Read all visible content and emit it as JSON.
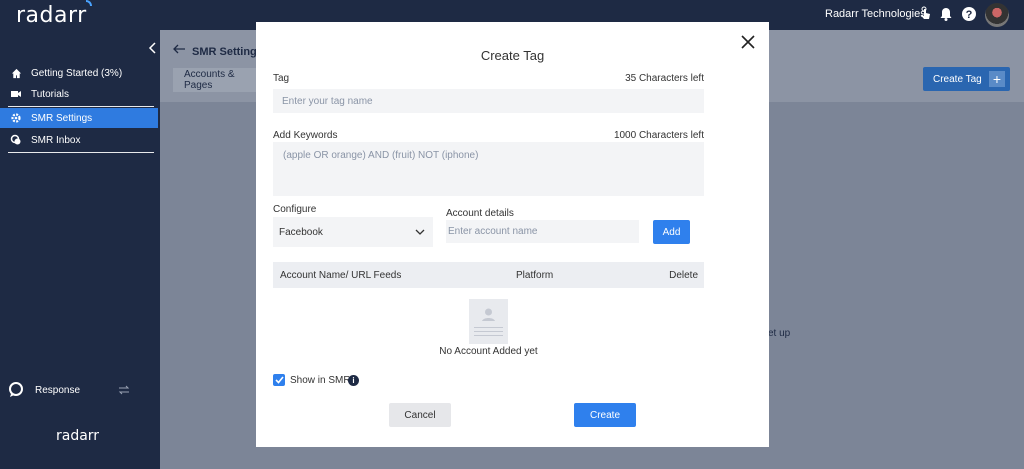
{
  "app": {
    "logo": "radarr",
    "org_name": "Radarr Technologies",
    "footer_logo": "radarr"
  },
  "colors": {
    "sidebar_bg": "#1e2a44",
    "accent": "#2f80ed",
    "active_nav": "#2f7be0"
  },
  "sidebar": {
    "items": [
      {
        "label": "Getting Started (3%)",
        "icon": "home-icon"
      },
      {
        "label": "Tutorials",
        "icon": "video-icon"
      },
      {
        "label": "SMR Settings",
        "icon": "gear-icon",
        "active": true
      },
      {
        "label": "SMR Inbox",
        "icon": "inbox-icon"
      }
    ],
    "response_label": "Response"
  },
  "main": {
    "page_title": "SMR Settings",
    "tab_label": "Accounts & Pages",
    "create_tag_label": "Create Tag",
    "background_text": "et up"
  },
  "modal": {
    "title": "Create Tag",
    "tag": {
      "label": "Tag",
      "counter": "35 Characters left",
      "placeholder": "Enter your tag name"
    },
    "keywords": {
      "label": "Add Keywords",
      "counter": "1000 Characters left",
      "placeholder": "(apple OR orange) AND (fruit) NOT (iphone)"
    },
    "configure": {
      "label": "Configure",
      "value": "Facebook"
    },
    "account_details": {
      "label": "Account details",
      "placeholder": "Enter account name",
      "add_label": "Add"
    },
    "table": {
      "columns": [
        "Account Name/ URL Feeds",
        "Platform",
        "Delete"
      ],
      "empty_text": "No Account Added yet"
    },
    "show_in_smr": {
      "label": "Show in SMR",
      "checked": true
    },
    "cancel_label": "Cancel",
    "create_label": "Create"
  }
}
